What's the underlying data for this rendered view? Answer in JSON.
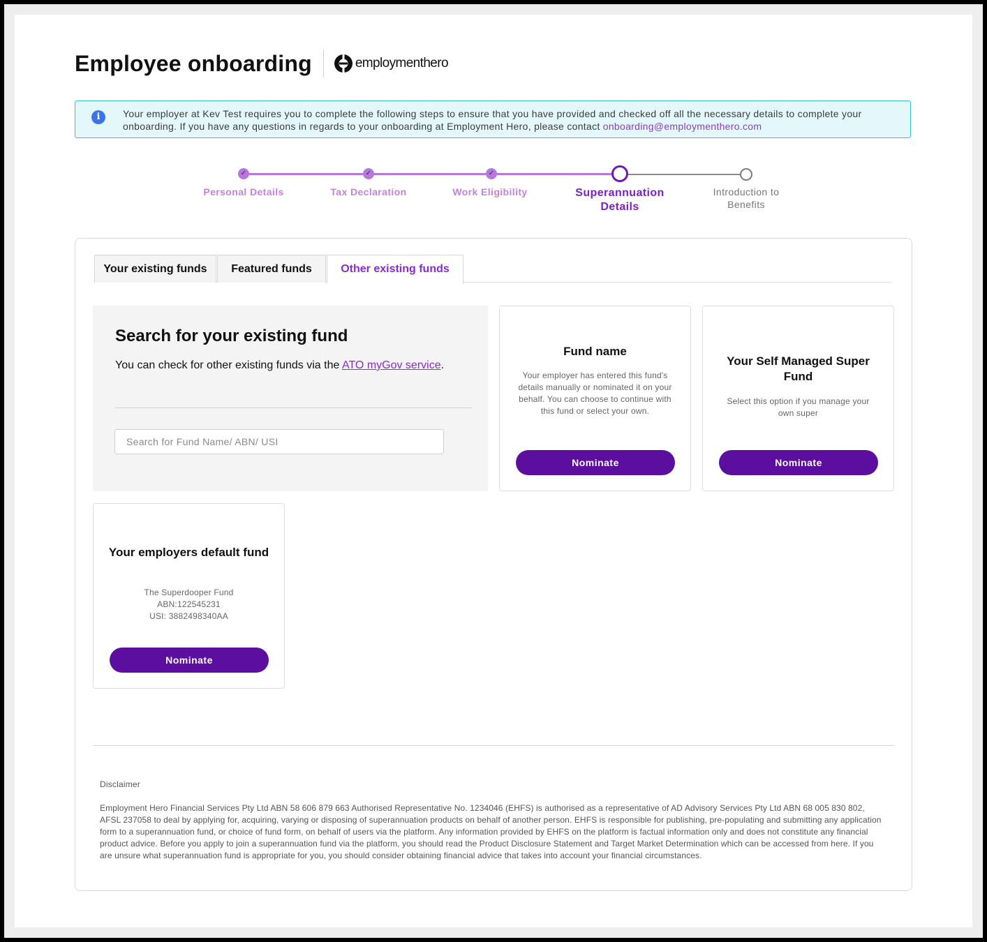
{
  "header": {
    "title": "Employee onboarding",
    "brand": "employmenthero"
  },
  "banner": {
    "icon": "info-icon",
    "text": "Your employer at Kev Test requires you to complete the following steps to ensure that you have provided and checked off all the necessary details to complete your onboarding. If you have any questions in regards to your onboarding at Employment Hero, please contact ",
    "email": "onboarding@employmenthero.com"
  },
  "stepper": {
    "steps": [
      {
        "label": "Personal Details",
        "status": "done"
      },
      {
        "label": "Tax Declaration",
        "status": "done"
      },
      {
        "label": "Work Eligibility",
        "status": "done"
      },
      {
        "label": "Superannuation Details",
        "status": "current"
      },
      {
        "label": "Introduction to Benefits",
        "status": "pending"
      }
    ]
  },
  "tabs": [
    {
      "label": "Your existing funds",
      "active": false
    },
    {
      "label": "Featured funds",
      "active": false
    },
    {
      "label": "Other existing funds",
      "active": true
    }
  ],
  "search": {
    "title": "Search for your existing fund",
    "desc_prefix": "You can check for other existing funds via the ",
    "link_text": "ATO myGov service",
    "desc_suffix": ".",
    "placeholder": "Search for Fund Name/ ABN/ USI"
  },
  "funds": [
    {
      "title": "Fund name",
      "desc": "Your employer has entered this fund's details manually or nominated it on your behalf. You can choose to continue with this fund or select your own.",
      "button": "Nominate"
    },
    {
      "title": "Your Self Managed Super Fund",
      "desc": "Select this option if you manage your own super",
      "button": "Nominate"
    },
    {
      "title": "Your employers default fund",
      "fund_name": "The Superdooper Fund",
      "abn": "ABN:122545231",
      "usi": "USI: 3882498340AA",
      "button": "Nominate"
    }
  ],
  "footer": {
    "disclaimer_title": "Disclaimer",
    "disclaimer_text": "Employment Hero Financial Services Pty Ltd ABN 58 606 879 663 Authorised Representative No. 1234046 (EHFS) is authorised as a representative of AD Advisory Services Pty Ltd ABN 68 005 830 802, AFSL 237058 to deal by applying for, acquiring, varying or disposing of superannuation products on behalf of another person. EHFS is responsible for publishing, pre-populating and submitting any application form to a superannuation fund, or choice of fund form, on behalf of users via the platform. Any information provided by EHFS on the platform is factual information only and does not constitute any financial product advice. Before you apply to join a superannuation fund via the platform, you should read the Product Disclosure Statement and Target Market Determination which can be accessed from here. If you are unsure what superannuation fund is appropriate for you, you should consider obtaining financial advice that takes into account your financial circumstances."
  },
  "colors": {
    "accent": "#5c0f9e",
    "step_done": "#b877dd",
    "step_current": "#6c1bb8",
    "banner_bg": "#e4f8fb",
    "banner_border": "#35c0cc"
  }
}
